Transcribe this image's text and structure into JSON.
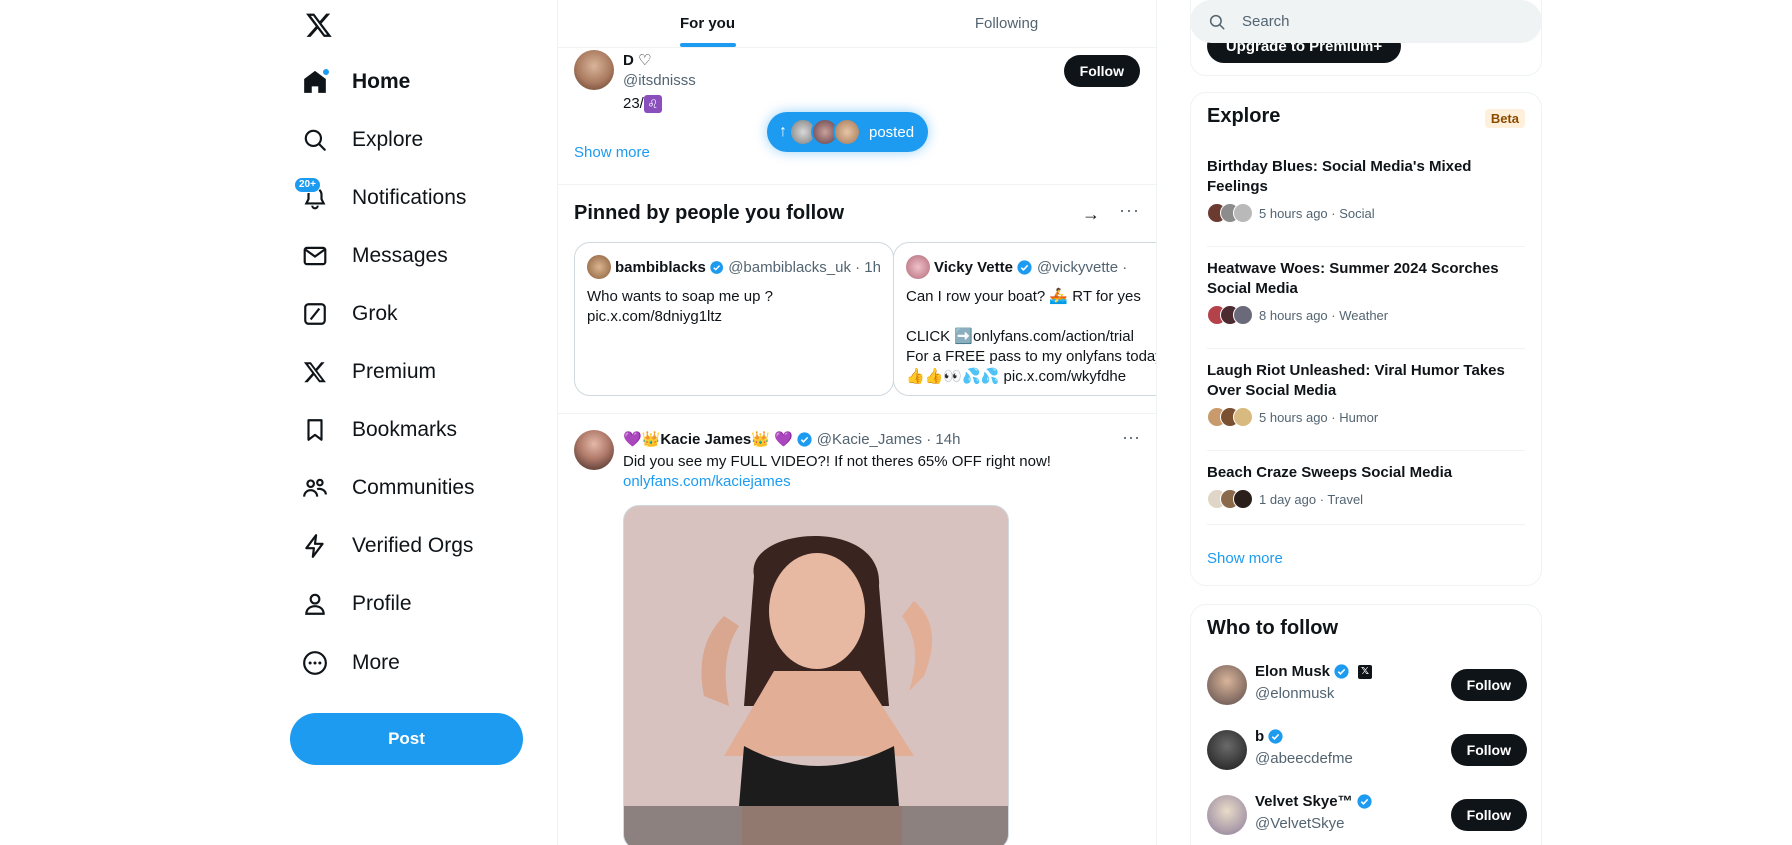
{
  "sidebar": {
    "logo": "X",
    "items": [
      {
        "label": "Home",
        "icon": "home-icon"
      },
      {
        "label": "Explore",
        "icon": "search-icon"
      },
      {
        "label": "Notifications",
        "icon": "bell-icon",
        "badge": "20+"
      },
      {
        "label": "Messages",
        "icon": "envelope-icon"
      },
      {
        "label": "Grok",
        "icon": "grok-icon"
      },
      {
        "label": "Premium",
        "icon": "x-icon"
      },
      {
        "label": "Bookmarks",
        "icon": "bookmark-icon"
      },
      {
        "label": "Communities",
        "icon": "people-icon"
      },
      {
        "label": "Verified Orgs",
        "icon": "lightning-icon"
      },
      {
        "label": "Profile",
        "icon": "person-icon"
      },
      {
        "label": "More",
        "icon": "more-circle-icon"
      }
    ],
    "post_label": "Post"
  },
  "tabs": [
    {
      "label": "For you"
    },
    {
      "label": "Following"
    }
  ],
  "top_tweet": {
    "name": "D ♡",
    "handle": "@itsdnisss",
    "bio_prefix": "23/",
    "bio_symbol": "♌",
    "follow_label": "Follow",
    "show_more": "Show more"
  },
  "posted_pill": {
    "text": "posted"
  },
  "pinned": {
    "title": "Pinned by people you follow",
    "cards": [
      {
        "name": "bambiblacks",
        "handle": "@bambiblacks_uk · 1h",
        "text": "Who wants to soap me up ?\npic.x.com/8dniyg1ltz"
      },
      {
        "name": "Vicky Vette",
        "handle": "@vickyvette ·",
        "text": "Can I row your boat? 🚣 RT for yes\n\nCLICK ➡️onlyfans.com/action/trial\nFor a FREE pass to my onlyfans today\n👍👍👀💦💦 pic.x.com/wkyfdhe"
      }
    ]
  },
  "main_tweet": {
    "name": "💜👑Kacie James👑 💜",
    "handle": "@Kacie_James · 14h",
    "text": "Did you see my FULL VIDEO?! If not theres 65% OFF right now!",
    "link": "onlyfans.com/kaciejames"
  },
  "search": {
    "placeholder": "Search"
  },
  "premium": {
    "button_label": "Upgrade to Premium+"
  },
  "explore": {
    "title": "Explore",
    "badge": "Beta",
    "trends": [
      {
        "title": "Birthday Blues: Social Media's Mixed Feelings",
        "meta": "5 hours ago · Social"
      },
      {
        "title": "Heatwave Woes: Summer 2024 Scorches Social Media",
        "meta": "8 hours ago · Weather"
      },
      {
        "title": "Laugh Riot Unleashed: Viral Humor Takes Over Social Media",
        "meta": "5 hours ago · Humor"
      },
      {
        "title": "Beach Craze Sweeps Social Media",
        "meta": "1 day ago · Travel"
      }
    ],
    "show_more": "Show more"
  },
  "who_to_follow": {
    "title": "Who to follow",
    "accounts": [
      {
        "name": "Elon Musk",
        "handle": "@elonmusk",
        "follow": "Follow"
      },
      {
        "name": "b",
        "handle": "@abeecdefme",
        "follow": "Follow"
      },
      {
        "name": "Velvet Skye™",
        "handle": "@VelvetSkye",
        "follow": "Follow"
      }
    ]
  },
  "colors": {
    "accent": "#1d9bf0",
    "text": "#0f1419",
    "muted": "#536471",
    "border": "#eff3f4"
  }
}
